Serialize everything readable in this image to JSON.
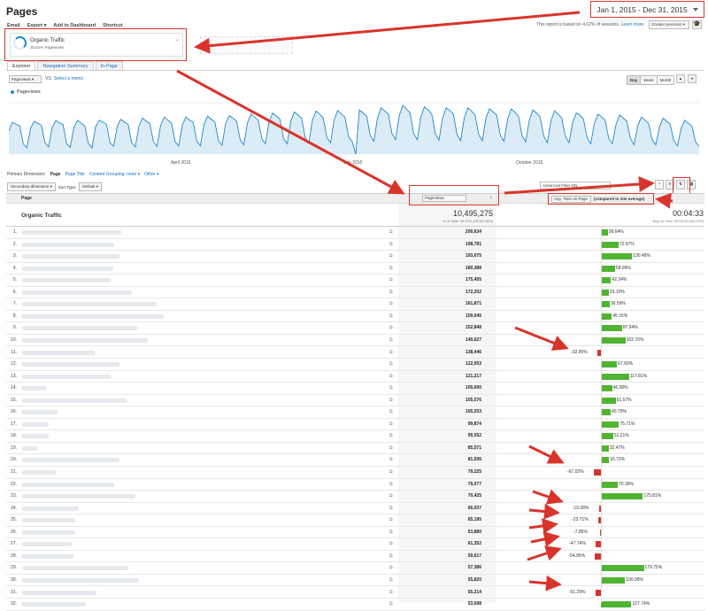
{
  "page": {
    "title": "Pages"
  },
  "toolbar": {
    "items": [
      "Email",
      "Export ▾",
      "Add to Dashboard",
      "Shortcut"
    ]
  },
  "date_range": {
    "label": "Jan 1, 2015 - Dec 31, 2015"
  },
  "sampling": {
    "note": "This report is based on 4.02% of sessions.",
    "learn_more": "Learn more",
    "precision": "Greater precision ▾"
  },
  "segment": {
    "name": "Organic Traffic",
    "sub": "35.51% Pageviews"
  },
  "tabs": [
    "Explorer",
    "Navigation Summary",
    "In-Page"
  ],
  "graph_controls": {
    "metric": "Pageviews ▾",
    "vs": "VS.",
    "select_metric": "Select a metric",
    "ranges": [
      "Day",
      "Week",
      "Month"
    ]
  },
  "legend": {
    "label": "Pageviews"
  },
  "chart_data": {
    "type": "line",
    "series": [
      {
        "name": "Pageviews",
        "values": [
          0.45,
          0.62,
          0.58,
          0.55,
          0.2,
          0.12,
          0.5,
          0.64,
          0.6,
          0.56,
          0.22,
          0.14,
          0.52,
          0.65,
          0.61,
          0.57,
          0.2,
          0.13,
          0.52,
          0.66,
          0.6,
          0.55,
          0.21,
          0.12,
          0.53,
          0.66,
          0.62,
          0.58,
          0.22,
          0.15,
          0.54,
          0.68,
          0.62,
          0.58,
          0.22,
          0.14,
          0.55,
          0.7,
          0.64,
          0.6,
          0.24,
          0.15,
          0.56,
          0.72,
          0.66,
          0.6,
          0.24,
          0.16,
          0.56,
          0.72,
          0.66,
          0.62,
          0.25,
          0.16,
          0.58,
          0.74,
          0.68,
          0.62,
          0.26,
          0.17,
          0.6,
          0.75,
          0.7,
          0.64,
          0.28,
          0.18,
          0.6,
          0.78,
          0.72,
          0.66,
          0.3,
          0.2,
          0.62,
          0.8,
          0.74,
          0.68,
          0.3,
          0.2,
          0.64,
          0.82,
          0.76,
          0.7,
          0.32,
          0.22,
          0.66,
          0.84,
          0.78,
          0.7,
          0.32,
          0.22,
          0.66,
          0.85,
          0.78,
          0.72,
          0.34,
          0.24,
          0.0,
          0.86,
          0.8,
          0.74,
          0.36,
          0.25,
          0.7,
          0.9,
          0.84,
          0.78,
          0.4,
          0.28,
          0.74,
          0.95,
          0.88,
          0.8,
          0.4,
          0.28,
          0.72,
          0.92,
          0.86,
          0.78,
          0.4,
          0.27,
          0.7,
          0.9,
          0.85,
          0.78,
          0.38,
          0.26,
          0.7,
          0.9,
          0.84,
          0.76,
          0.38,
          0.26,
          0.7,
          0.88,
          0.82,
          0.76,
          0.36,
          0.25,
          0.68,
          0.88,
          0.82,
          0.74,
          0.36,
          0.24,
          0.66,
          0.86,
          0.8,
          0.72,
          0.35,
          0.22,
          0.65,
          0.84,
          0.78,
          0.7,
          0.34,
          0.22,
          0.62,
          0.8,
          0.76,
          0.68,
          0.32,
          0.2,
          0.6,
          0.78,
          0.72,
          0.66,
          0.3,
          0.2,
          0.58,
          0.76,
          0.7,
          0.64,
          0.3,
          0.18,
          0.55,
          0.72,
          0.66,
          0.6,
          0.28,
          0.18,
          0.52,
          0.7,
          0.64,
          0.58,
          0.26,
          0.16,
          0.5,
          0.66,
          0.6,
          0.55,
          0.24,
          0.15
        ]
      }
    ],
    "x_labels": [
      "April 2015",
      "July 2015",
      "October 2015"
    ],
    "ylim": [
      0,
      1
    ]
  },
  "primary_dimension": {
    "label": "Primary Dimension:",
    "current": "Page",
    "others": [
      "Page Title",
      "Content Grouping: none ▾",
      "Other ▾"
    ]
  },
  "table_controls": {
    "secondary": "Secondary dimension ▾",
    "sort_label": "Sort Type:",
    "sort_value": "Default ▾",
    "advanced": "Advanced Filter ON"
  },
  "table": {
    "page_header": "Page",
    "pv_header": "Pageviews",
    "avg_header": "Avg. Time on Page",
    "avg_note": "(compared to site average)",
    "totals": {
      "name": "Organic Traffic",
      "pageviews": "10,495,275",
      "pv_sub": "% of Total: 36.40% (28,562,853)",
      "avg": "00:04:33",
      "avg_sub": "Avg for View: 00:03:20 (36.19%)"
    },
    "rows": [
      {
        "idx": "1.",
        "pv": "200,634",
        "pct": 28.64,
        "pct_label": "28.64%"
      },
      {
        "idx": "2.",
        "pv": "198,781",
        "pct": 72.97,
        "pct_label": "72.97%"
      },
      {
        "idx": "3.",
        "pv": "193,675",
        "pct": 130.45,
        "pct_label": "130.45%"
      },
      {
        "idx": "4.",
        "pv": "180,388",
        "pct": 58.99,
        "pct_label": "58.99%"
      },
      {
        "idx": "5.",
        "pv": "175,455",
        "pct": 42.34,
        "pct_label": "42.34%"
      },
      {
        "idx": "6.",
        "pv": "172,202",
        "pct": 33.1,
        "pct_label": "33.10%"
      },
      {
        "idx": "7.",
        "pv": "161,871",
        "pct": 36.59,
        "pct_label": "36.59%"
      },
      {
        "idx": "8.",
        "pv": "159,045",
        "pct": 45.15,
        "pct_label": "45.15%"
      },
      {
        "idx": "9.",
        "pv": "152,848",
        "pct": 87.94,
        "pct_label": "87.94%"
      },
      {
        "idx": "10.",
        "pv": "140,627",
        "pct": 102.7,
        "pct_label": "102.70%"
      },
      {
        "idx": "11.",
        "pv": "138,446",
        "pct": -32.95,
        "pct_label": "-32.95%"
      },
      {
        "idx": "12.",
        "pv": "122,053",
        "pct": 67.6,
        "pct_label": "67.60%"
      },
      {
        "idx": "13.",
        "pv": "121,217",
        "pct": 117.81,
        "pct_label": "117.81%"
      },
      {
        "idx": "14.",
        "pv": "109,690",
        "pct": 46.58,
        "pct_label": "46.58%"
      },
      {
        "idx": "15.",
        "pv": "105,576",
        "pct": 61.57,
        "pct_label": "61.57%"
      },
      {
        "idx": "16.",
        "pv": "105,253",
        "pct": 40.79,
        "pct_label": "40.79%"
      },
      {
        "idx": "17.",
        "pv": "99,874",
        "pct": 75.71,
        "pct_label": "75.71%"
      },
      {
        "idx": "18.",
        "pv": "99,552",
        "pct": 51.21,
        "pct_label": "51.21%"
      },
      {
        "idx": "19.",
        "pv": "85,571",
        "pct": 32.47,
        "pct_label": "32.47%"
      },
      {
        "idx": "20.",
        "pv": "81,506",
        "pct": 33.72,
        "pct_label": "33.72%"
      },
      {
        "idx": "21.",
        "pv": "79,225",
        "pct": -67.02,
        "pct_label": "-67.02%"
      },
      {
        "idx": "22.",
        "pv": "79,077",
        "pct": 70.39,
        "pct_label": "70.39%"
      },
      {
        "idx": "23.",
        "pv": "70,425",
        "pct": 175.81,
        "pct_label": "175.81%"
      },
      {
        "idx": "24.",
        "pv": "66,037",
        "pct": -19.28,
        "pct_label": "-19.28%"
      },
      {
        "idx": "25.",
        "pv": "65,195",
        "pct": -23.71,
        "pct_label": "-23.71%"
      },
      {
        "idx": "26.",
        "pv": "63,880",
        "pct": -7.85,
        "pct_label": "-7.85%"
      },
      {
        "idx": "27.",
        "pv": "61,352",
        "pct": -47.74,
        "pct_label": "-47.74%"
      },
      {
        "idx": "28.",
        "pv": "59,617",
        "pct": -54.95,
        "pct_label": "-54.95%"
      },
      {
        "idx": "29.",
        "pv": "57,386",
        "pct": 179.75,
        "pct_label": "179.75%"
      },
      {
        "idx": "30.",
        "pv": "55,820",
        "pct": 100.99,
        "pct_label": "100.99%"
      },
      {
        "idx": "31.",
        "pv": "55,214",
        "pct": -51.29,
        "pct_label": "-51.29%"
      },
      {
        "idx": "32.",
        "pv": "53,698",
        "pct": 127.74,
        "pct_label": "127.74%"
      }
    ]
  },
  "colors": {
    "accent": "#1f87c9",
    "positive": "#50b432",
    "negative": "#d9342b",
    "annotation": "#d9342b"
  }
}
